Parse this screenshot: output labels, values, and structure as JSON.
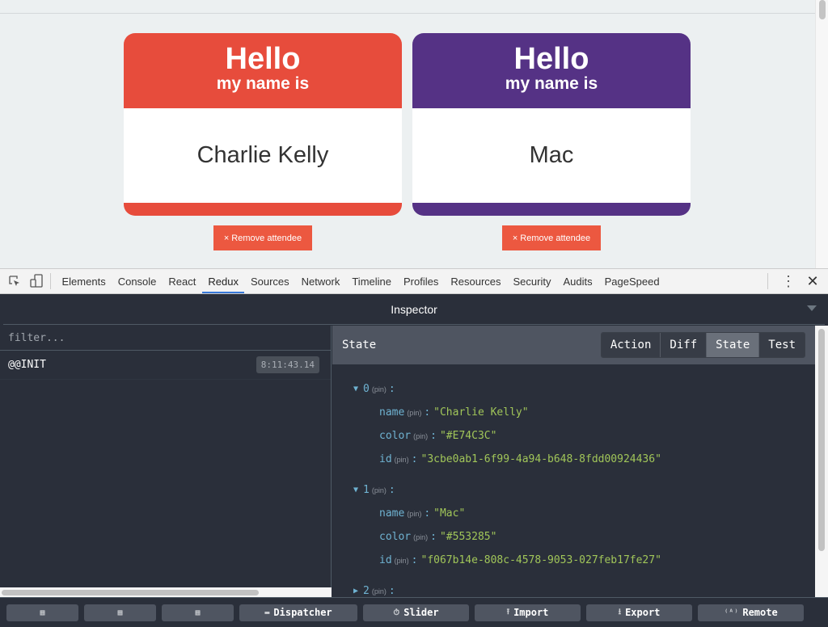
{
  "page": {
    "badges": [
      {
        "hello": "Hello",
        "subtitle": "my name is",
        "name": "Charlie Kelly",
        "color": "#E74C3C",
        "remove_label": "× Remove attendee"
      },
      {
        "hello": "Hello",
        "subtitle": "my name is",
        "name": "Mac",
        "color": "#553285",
        "remove_label": "× Remove attendee"
      }
    ]
  },
  "devtools": {
    "tabs": [
      "Elements",
      "Console",
      "React",
      "Redux",
      "Sources",
      "Network",
      "Timeline",
      "Profiles",
      "Resources",
      "Security",
      "Audits",
      "PageSpeed"
    ],
    "active_tab": "Redux"
  },
  "redux": {
    "inspector_title": "Inspector",
    "filter_placeholder": "filter...",
    "actions": [
      {
        "type": "@@INIT",
        "time": "8:11:43.14"
      }
    ],
    "state_label": "State",
    "view_buttons": [
      "Action",
      "Diff",
      "State",
      "Test"
    ],
    "active_view": "State",
    "pin": "(pin)",
    "tree": [
      {
        "key": "0",
        "expanded": true,
        "fields": [
          {
            "key": "name",
            "value": "\"Charlie Kelly\""
          },
          {
            "key": "color",
            "value": "\"#E74C3C\""
          },
          {
            "key": "id",
            "value": "\"3cbe0ab1-6f99-4a94-b648-8fdd00924436\""
          }
        ]
      },
      {
        "key": "1",
        "expanded": true,
        "fields": [
          {
            "key": "name",
            "value": "\"Mac\""
          },
          {
            "key": "color",
            "value": "\"#553285\""
          },
          {
            "key": "id",
            "value": "\"f067b14e-808c-4578-9053-027feb17fe27\""
          }
        ]
      },
      {
        "key": "2",
        "expanded": false,
        "fields": []
      }
    ],
    "bottom_buttons": [
      {
        "label": "",
        "icon": "layout-left-icon"
      },
      {
        "label": "",
        "icon": "layout-right-icon"
      },
      {
        "label": "",
        "icon": "layout-bottom-icon"
      },
      {
        "label": "Dispatcher",
        "icon": "keyboard-icon",
        "glyph": "▬"
      },
      {
        "label": "Slider",
        "icon": "stopwatch-icon",
        "glyph": "⏱"
      },
      {
        "label": "Import",
        "icon": "upload-icon",
        "glyph": "⭱"
      },
      {
        "label": "Export",
        "icon": "download-icon",
        "glyph": "⭳"
      },
      {
        "label": "Remote",
        "icon": "remote-icon",
        "glyph": "⁽ᴬ⁾"
      }
    ]
  }
}
